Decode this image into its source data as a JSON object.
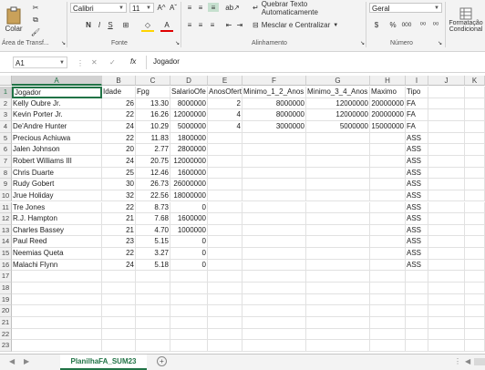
{
  "ribbon": {
    "paste_label": "Colar",
    "clipboard_label": "Área de Transf...",
    "font_group_label": "Fonte",
    "align_group_label": "Alinhamento",
    "number_group_label": "Número",
    "font_name": "Calibri",
    "font_size": "11",
    "grow_font": "A^",
    "shrink_font": "Aˇ",
    "bold": "N",
    "italic": "I",
    "underline": "S",
    "wrap_text": "Quebrar Texto Automaticamente",
    "merge_center": "Mesclar e Centralizar",
    "number_format": "Geral",
    "currency": "$",
    "percent": "%",
    "thousands": "000",
    "inc_decimal": "⁰⁰",
    "dec_decimal": "⁰⁰",
    "cond_format": "Formatação",
    "cond_format2": "Condicional"
  },
  "formula_bar": {
    "name_box": "A1",
    "fx": "fx",
    "content": "Jogador"
  },
  "columns": [
    "A",
    "B",
    "C",
    "D",
    "E",
    "F",
    "G",
    "H",
    "I",
    "J",
    "K"
  ],
  "rows": [
    [
      "Jogador",
      "Idade",
      "Fpg",
      "SalarioOfe",
      "AnosOfert",
      "Minimo_1_2_Anos",
      "Minimo_3_4_Anos",
      "Maximo",
      "Tipo"
    ],
    [
      "Kelly Oubre Jr.",
      "26",
      "13.30",
      "8000000",
      "2",
      "8000000",
      "12000000",
      "20000000",
      "FA"
    ],
    [
      "Kevin Porter Jr.",
      "22",
      "16.26",
      "12000000",
      "4",
      "8000000",
      "12000000",
      "20000000",
      "FA"
    ],
    [
      "De'Andre Hunter",
      "24",
      "10.29",
      "5000000",
      "4",
      "3000000",
      "5000000",
      "15000000",
      "FA"
    ],
    [
      "Precious Achiuwa",
      "22",
      "11.83",
      "1800000",
      "",
      "",
      "",
      "",
      "ASS"
    ],
    [
      "Jalen Johnson",
      "20",
      "2.77",
      "2800000",
      "",
      "",
      "",
      "",
      "ASS"
    ],
    [
      "Robert Williams III",
      "24",
      "20.75",
      "12000000",
      "",
      "",
      "",
      "",
      "ASS"
    ],
    [
      "Chris Duarte",
      "25",
      "12.46",
      "1600000",
      "",
      "",
      "",
      "",
      "ASS"
    ],
    [
      "Rudy Gobert",
      "30",
      "26.73",
      "26000000",
      "",
      "",
      "",
      "",
      "ASS"
    ],
    [
      "Jrue Holiday",
      "32",
      "22.56",
      "18000000",
      "",
      "",
      "",
      "",
      "ASS"
    ],
    [
      "Tre Jones",
      "22",
      "8.73",
      "0",
      "",
      "",
      "",
      "",
      "ASS"
    ],
    [
      "R.J. Hampton",
      "21",
      "7.68",
      "1600000",
      "",
      "",
      "",
      "",
      "ASS"
    ],
    [
      "Charles Bassey",
      "21",
      "4.70",
      "1000000",
      "",
      "",
      "",
      "",
      "ASS"
    ],
    [
      "Paul Reed",
      "23",
      "5.15",
      "0",
      "",
      "",
      "",
      "",
      "ASS"
    ],
    [
      "Neemias Queta",
      "22",
      "3.27",
      "0",
      "",
      "",
      "",
      "",
      "ASS"
    ],
    [
      "Malachi Flynn",
      "24",
      "5.18",
      "0",
      "",
      "",
      "",
      "",
      "ASS"
    ]
  ],
  "row_numbers": [
    "1",
    "2",
    "3",
    "4",
    "5",
    "6",
    "7",
    "8",
    "9",
    "10",
    "11",
    "12",
    "13",
    "14",
    "15",
    "16",
    "17",
    "18",
    "19",
    "20",
    "21",
    "22",
    "23"
  ],
  "sheet_tab": "PlanilhaFA_SUM23",
  "add_sheet": "+",
  "colors": {
    "accent": "#217346",
    "selection": "#217346"
  }
}
